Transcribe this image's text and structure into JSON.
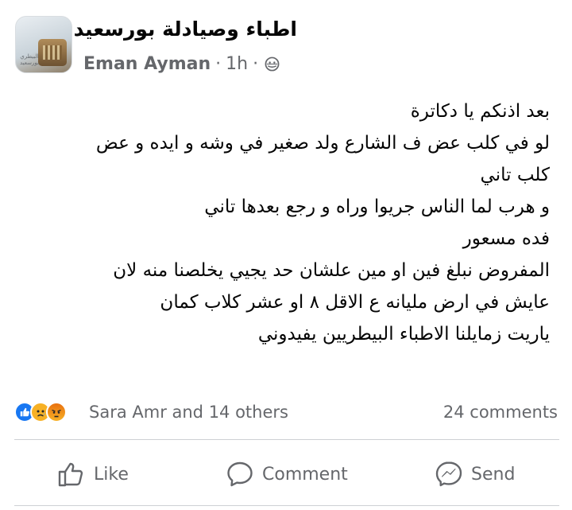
{
  "group": {
    "name": "اطباء وصيادلة بورسعيد",
    "avatar_text": "البيطري بورسعيد"
  },
  "post_meta": {
    "author": "Eman Ayman",
    "separator": "·",
    "time": "1h",
    "privacy_icon": "globe-icon"
  },
  "post_lines": [
    "بعد اذنكم يا دكاترة",
    "لو في كلب عض ف الشارع ولد صغير في وشه و ايده و عض",
    "كلب تاني",
    "و هرب لما الناس جريوا وراه و رجع بعدها تاني",
    "فده مسعور",
    "المفروض نبلغ فين او مين علشان حد يجيي يخلصنا منه لان",
    "عايش في ارض مليانه ع الاقل ٨ او عشر كلاب كمان",
    "ياريت زمايلنا الاطباء  البيطريين يفيدوني"
  ],
  "reactions": {
    "icons": [
      "like-icon",
      "sad-icon",
      "angry-icon"
    ],
    "text": "Sara Amr and 14 others",
    "comments": "24 comments"
  },
  "actions": {
    "like": "Like",
    "comment": "Comment",
    "send": "Send"
  },
  "colors": {
    "text_primary": "#050505",
    "text_secondary": "#65676b",
    "like_blue": "#1877f2",
    "sad_yellow": "#f7b125",
    "angry_orange": "#e9710f",
    "divider": "#ced0d4"
  }
}
